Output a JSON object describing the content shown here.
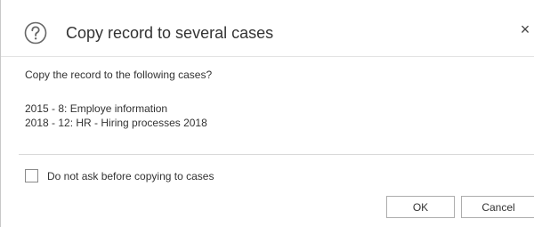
{
  "dialog": {
    "title": "Copy record to several cases",
    "help_icon": "help-circle-icon",
    "close_label": "×",
    "question": "Copy the record to the following cases?",
    "cases": [
      "2015 - 8: Employe information",
      "2018 - 12: HR - Hiring processes 2018"
    ],
    "checkbox": {
      "label": "Do not ask before copying to cases",
      "checked": false
    },
    "buttons": {
      "ok_label": "OK",
      "cancel_label": "Cancel"
    }
  }
}
